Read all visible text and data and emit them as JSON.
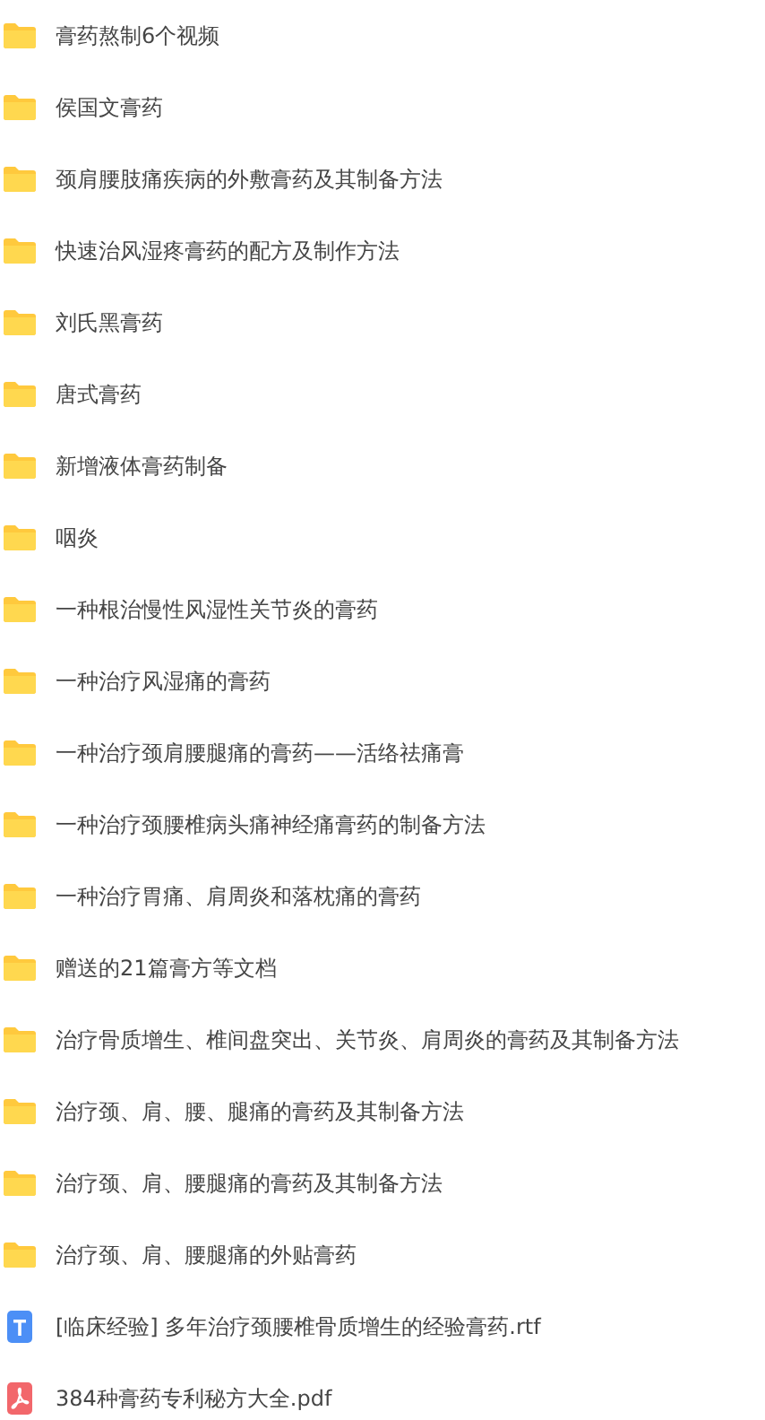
{
  "files": [
    {
      "kind": "folder",
      "name": "膏药熬制6个视频"
    },
    {
      "kind": "folder",
      "name": "侯国文膏药"
    },
    {
      "kind": "folder",
      "name": "颈肩腰肢痛疾病的外敷膏药及其制备方法"
    },
    {
      "kind": "folder",
      "name": "快速治风湿疼膏药的配方及制作方法"
    },
    {
      "kind": "folder",
      "name": "刘氏黑膏药"
    },
    {
      "kind": "folder",
      "name": "唐式膏药"
    },
    {
      "kind": "folder",
      "name": "新增液体膏药制备"
    },
    {
      "kind": "folder",
      "name": "咽炎"
    },
    {
      "kind": "folder",
      "name": "一种根治慢性风湿性关节炎的膏药"
    },
    {
      "kind": "folder",
      "name": "一种治疗风湿痛的膏药"
    },
    {
      "kind": "folder",
      "name": "一种治疗颈肩腰腿痛的膏药——活络祛痛膏"
    },
    {
      "kind": "folder",
      "name": "一种治疗颈腰椎病头痛神经痛膏药的制备方法"
    },
    {
      "kind": "folder",
      "name": "一种治疗胃痛、肩周炎和落枕痛的膏药"
    },
    {
      "kind": "folder",
      "name": "赠送的21篇膏方等文档"
    },
    {
      "kind": "folder",
      "name": "治疗骨质增生、椎间盘突出、关节炎、肩周炎的膏药及其制备方法"
    },
    {
      "kind": "folder",
      "name": "治疗颈、肩、腰、腿痛的膏药及其制备方法"
    },
    {
      "kind": "folder",
      "name": "治疗颈、肩、腰腿痛的膏药及其制备方法"
    },
    {
      "kind": "folder",
      "name": "治疗颈、肩、腰腿痛的外贴膏药"
    },
    {
      "kind": "rtf",
      "name": "[临床经验] 多年治疗颈腰椎骨质增生的经验膏药.rtf"
    },
    {
      "kind": "pdf",
      "name": "384种膏药专利秘方大全.pdf"
    }
  ]
}
